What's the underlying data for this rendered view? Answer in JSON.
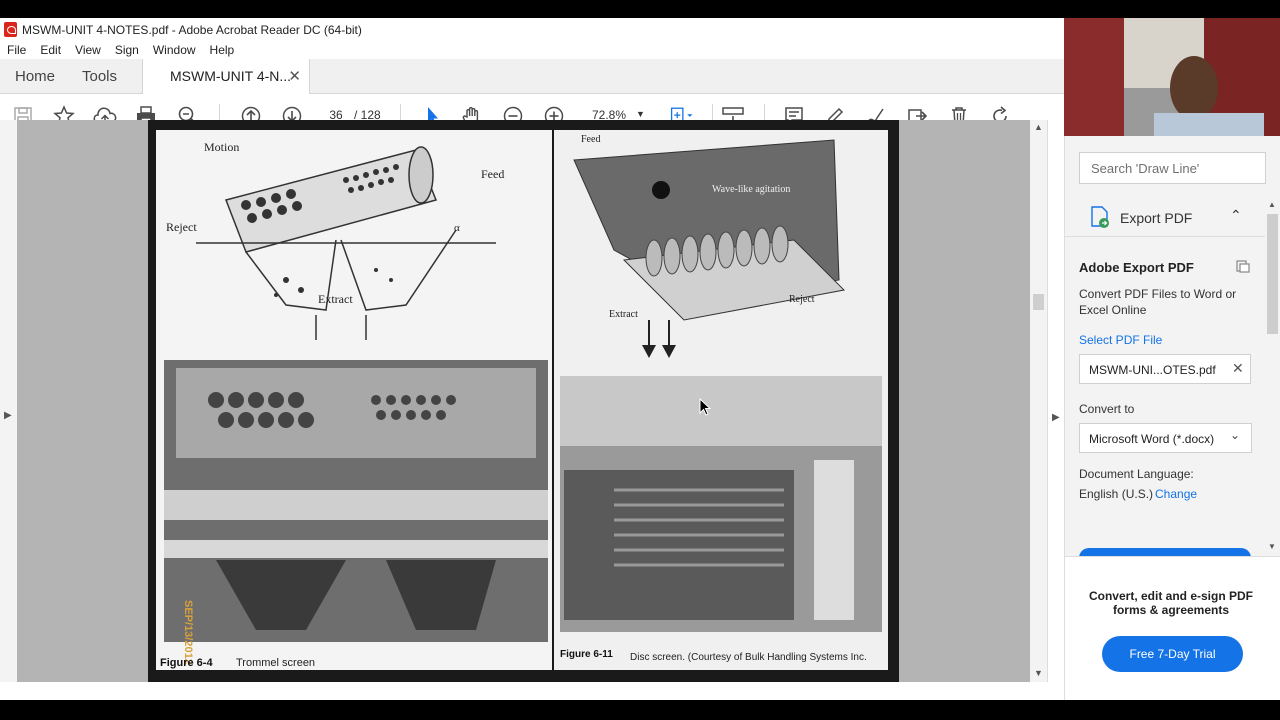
{
  "window": {
    "title": "MSWM-UNIT 4-NOTES.pdf - Adobe Acrobat Reader DC (64-bit)"
  },
  "menu": [
    "File",
    "Edit",
    "View",
    "Sign",
    "Window",
    "Help"
  ],
  "tabs": {
    "home": "Home",
    "tools": "Tools",
    "document": "MSWM-UNIT 4-N..."
  },
  "toolbar": {
    "page_current": "36",
    "page_total": "/   128",
    "zoom": "72.8%"
  },
  "document": {
    "left_figure": {
      "labels": [
        "Motion",
        "Feed",
        "Reject",
        "Extract",
        "α"
      ],
      "stamp": "SEP/13/2012",
      "caption_number": "Figure 6-4",
      "caption_text": "Trommel screen"
    },
    "right_figure": {
      "labels": [
        "Feed",
        "Wave-like agitation",
        "Extract",
        "Reject"
      ],
      "caption_number": "Figure 6-11",
      "caption_text": "Disc screen. (Courtesy of Bulk Handling Systems Inc."
    }
  },
  "right_panel": {
    "search_placeholder": "Search 'Draw Line'",
    "export_header": "Export PDF",
    "adobe_export_title": "Adobe Export PDF",
    "adobe_export_desc": "Convert PDF Files to Word or Excel Online",
    "select_label": "Select PDF File",
    "selected_file": "MSWM-UNI...OTES.pdf",
    "convert_to_label": "Convert to",
    "convert_to_value": "Microsoft Word (*.docx)",
    "doc_language_label": "Document Language:",
    "doc_language_value": "English (U.S.)",
    "change_link": "Change",
    "promo_text": "Convert, edit and e-sign PDF forms & agreements",
    "trial_button": "Free 7-Day Trial"
  },
  "colors": {
    "accent": "#1473e6",
    "pdf_red": "#d9251c",
    "caption_gold": "#d8a03a"
  }
}
